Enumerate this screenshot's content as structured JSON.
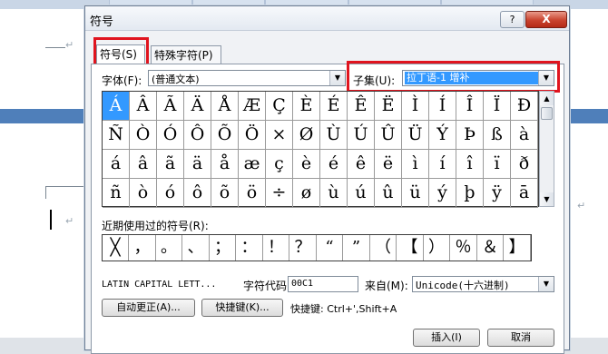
{
  "dialog": {
    "title": "符号",
    "help_label": "?",
    "close_label": "X"
  },
  "tabs": [
    {
      "label": "符号(S)"
    },
    {
      "label": "特殊字符(P)"
    }
  ],
  "font": {
    "label": "字体(F):",
    "value": "(普通文本)"
  },
  "subset": {
    "label": "子集(U):",
    "value": "拉丁语-1 增补"
  },
  "symbols": [
    [
      "Á",
      "Â",
      "Ã",
      "Ä",
      "Å",
      "Æ",
      "Ç",
      "È",
      "É",
      "Ê",
      "Ë",
      "Ì",
      "Í",
      "Î",
      "Ï",
      "Ð"
    ],
    [
      "Ñ",
      "Ò",
      "Ó",
      "Ô",
      "Õ",
      "Ö",
      "×",
      "Ø",
      "Ù",
      "Ú",
      "Û",
      "Ü",
      "Ý",
      "Þ",
      "ß",
      "à"
    ],
    [
      "á",
      "â",
      "ã",
      "ä",
      "å",
      "æ",
      "ç",
      "è",
      "é",
      "ê",
      "ë",
      "ì",
      "í",
      "î",
      "ï",
      "ð"
    ],
    [
      "ñ",
      "ò",
      "ó",
      "ô",
      "õ",
      "ö",
      "÷",
      "ø",
      "ù",
      "ú",
      "û",
      "ü",
      "ý",
      "þ",
      "ÿ",
      "ā"
    ]
  ],
  "selected_symbol": "Á",
  "recent": {
    "label": "近期使用过的符号(R):",
    "symbols": [
      "╳",
      "，",
      "。",
      "、",
      "；",
      "：",
      "！",
      "？",
      "“",
      "”",
      "（",
      "【",
      "）",
      "％",
      "＆",
      "】"
    ]
  },
  "char_name": "LATIN CAPITAL LETT...",
  "char_code": {
    "label": "字符代码(C):",
    "value": "00C1"
  },
  "from": {
    "label": "来自(M):",
    "value": "Unicode(十六进制)"
  },
  "buttons": {
    "autocorrect": "自动更正(A)...",
    "shortcut_key": "快捷键(K)...",
    "insert": "插入(I)",
    "cancel": "取消"
  },
  "shortcut_info": "快捷键: Ctrl+',Shift+A",
  "colors": {
    "highlight": "#e0141e",
    "selection": "#3399ff"
  }
}
